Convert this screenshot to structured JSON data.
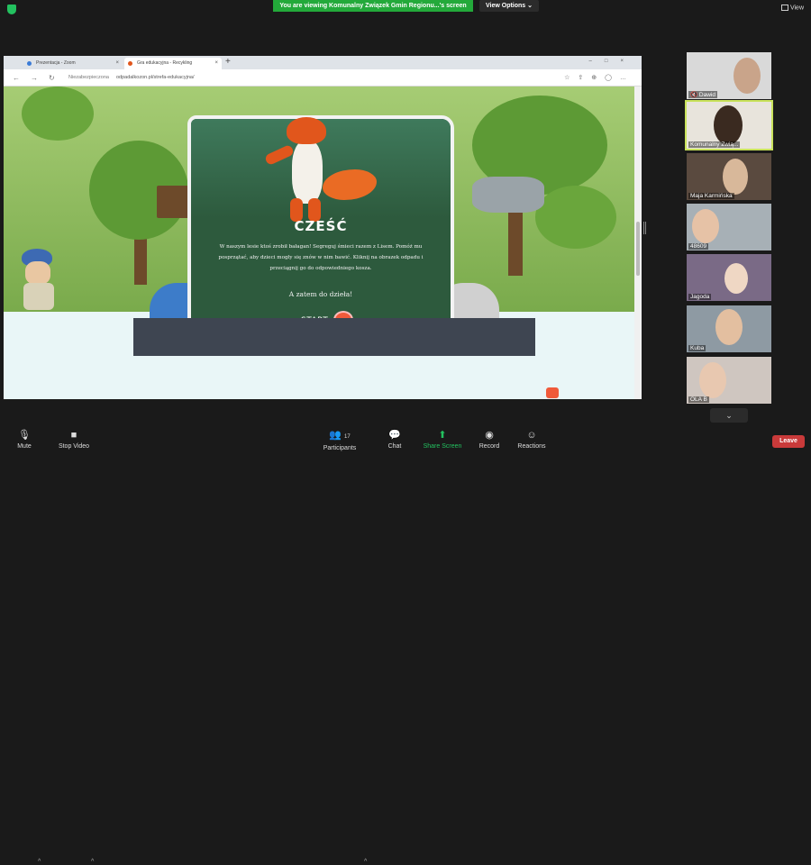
{
  "topbar": {
    "banner": "You are viewing Komunalny Związek Gmin Regionu...'s screen",
    "view_options": "View Options ⌄",
    "view_button": "View"
  },
  "browser": {
    "tabs": [
      {
        "label": "Prezentacja - Zoom"
      },
      {
        "label": "Gra edukacyjna - Recykling"
      }
    ],
    "new_tab": "+",
    "url_security": "Niezabezpieczona",
    "url": "odpadalkozon.pl/strefa-edukacyjna/"
  },
  "game": {
    "heading": "CZEŚĆ",
    "body": "W naszym lesie ktoś zrobił bałagan! Segreguj śmieci razem z Lisem. Pomóż mu posprzątać, aby dzieci mogły się znów w nim bawić. Kliknij na obrazek odpadu i przeciągnij go do odpowiedniego kosza.",
    "cta": "A zatem do dzieła!",
    "start": "START",
    "go_icon": "arrow-right-icon"
  },
  "participants": [
    {
      "name": "Dawid",
      "muted": true
    },
    {
      "name": "Komunalny Zwią...",
      "active": true
    },
    {
      "name": "Maja Karmińska"
    },
    {
      "name": "48609"
    },
    {
      "name": "Jagoda"
    },
    {
      "name": "Kuba"
    },
    {
      "name": "OLA B"
    }
  ],
  "toolbar": {
    "mute": "Mute",
    "stop_video": "Stop Video",
    "participants": "Participants",
    "participants_count": "17",
    "chat": "Chat",
    "share_screen": "Share Screen",
    "record": "Record",
    "reactions": "Reactions",
    "leave": "Leave"
  },
  "colors": {
    "zoom_green": "#23a93a",
    "leave_red": "#c93a3a",
    "active_speaker": "#c9e25b",
    "game_panel": "#2d5a3d",
    "start_button": "#f05a3a"
  }
}
